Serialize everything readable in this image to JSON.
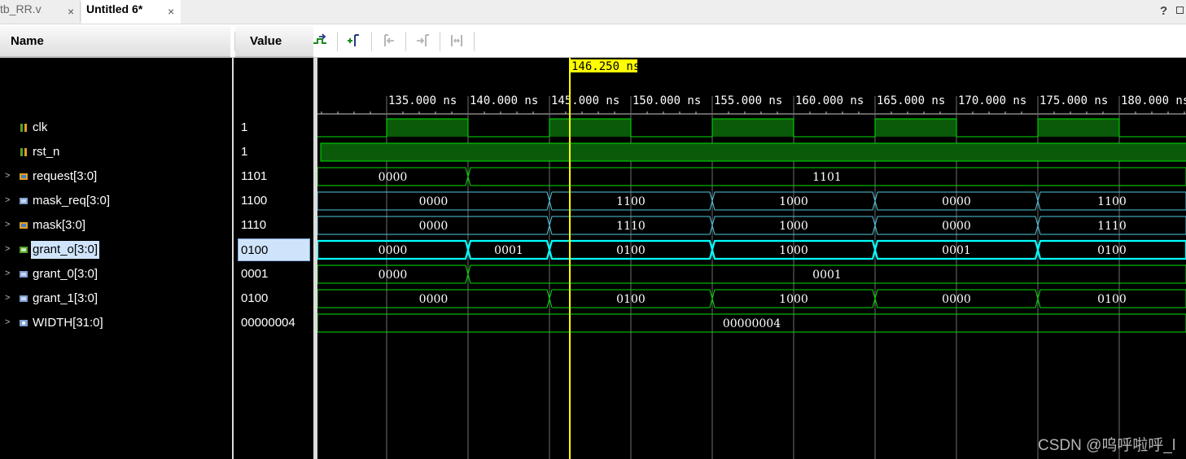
{
  "tabs": [
    {
      "label": "tb_RR.v",
      "close": "×",
      "active": false
    },
    {
      "label": "Untitled 6*",
      "close": "×",
      "active": true
    }
  ],
  "window_controls": {
    "help": "?"
  },
  "toolbar": [
    {
      "name": "search-icon",
      "enabled": true
    },
    {
      "name": "save-icon",
      "enabled": true
    },
    {
      "name": "zoom-in-icon",
      "enabled": true
    },
    {
      "name": "zoom-out-icon",
      "enabled": true
    },
    {
      "name": "zoom-fit-icon",
      "enabled": true
    },
    {
      "name": "go-to-cursor-icon",
      "enabled": true
    },
    {
      "name": "go-to-time-zero-icon",
      "enabled": true
    },
    {
      "name": "go-to-last-time-icon",
      "enabled": true
    },
    {
      "name": "previous-transition-icon",
      "enabled": true
    },
    {
      "name": "next-transition-icon",
      "enabled": true
    },
    {
      "name": "add-marker-icon",
      "enabled": true
    },
    {
      "name": "previous-marker-icon",
      "enabled": false
    },
    {
      "name": "next-marker-icon",
      "enabled": false
    },
    {
      "name": "swap-cursors-icon",
      "enabled": false
    }
  ],
  "columns": {
    "name": "Name",
    "value": "Value"
  },
  "signals": [
    {
      "name": "clk",
      "value": "1",
      "expandable": false,
      "icon": "bit-signal-icon",
      "type": "clock"
    },
    {
      "name": "rst_n",
      "value": "1",
      "expandable": false,
      "icon": "bit-signal-icon",
      "type": "bit"
    },
    {
      "name": "request[3:0]",
      "value": "1101",
      "expandable": true,
      "icon": "input-bus-icon",
      "type": "bus"
    },
    {
      "name": "mask_req[3:0]",
      "value": "1100",
      "expandable": true,
      "icon": "bus-icon",
      "type": "bus"
    },
    {
      "name": "mask[3:0]",
      "value": "1110",
      "expandable": true,
      "icon": "input-bus-icon",
      "type": "bus"
    },
    {
      "name": "grant_o[3:0]",
      "value": "0100",
      "expandable": true,
      "icon": "output-bus-icon",
      "type": "bus",
      "selected": true
    },
    {
      "name": "grant_0[3:0]",
      "value": "0001",
      "expandable": true,
      "icon": "bus-icon",
      "type": "bus"
    },
    {
      "name": "grant_1[3:0]",
      "value": "0100",
      "expandable": true,
      "icon": "bus-icon",
      "type": "bus"
    },
    {
      "name": "WIDTH[31:0]",
      "value": "00000004",
      "expandable": true,
      "icon": "parameter-bus-icon",
      "type": "bus"
    }
  ],
  "timeline": {
    "unit": "ns",
    "cursor": 146.25,
    "cursor_label": "146.250 ns",
    "start": 130.75,
    "end": 184.1,
    "ticks": [
      {
        "t": 135,
        "label": "135.000 ns"
      },
      {
        "t": 140,
        "label": "140.000 ns"
      },
      {
        "t": 145,
        "label": "145.000 ns"
      },
      {
        "t": 150,
        "label": "150.000 ns"
      },
      {
        "t": 155,
        "label": "155.000 ns"
      },
      {
        "t": 160,
        "label": "160.000 ns"
      },
      {
        "t": 165,
        "label": "165.000 ns"
      },
      {
        "t": 170,
        "label": "170.000 ns"
      },
      {
        "t": 175,
        "label": "175.000 ns"
      },
      {
        "t": 180,
        "label": "180.000 ns"
      }
    ]
  },
  "waveforms": {
    "clk": {
      "high_intervals": [
        [
          135,
          140
        ],
        [
          145,
          150
        ],
        [
          155,
          160
        ],
        [
          165,
          170
        ],
        [
          175,
          180
        ]
      ]
    },
    "rst_n": {
      "level": 1
    },
    "request": {
      "color": "#00e000",
      "segments": [
        {
          "start": 130.75,
          "end": 140,
          "label": "0000"
        },
        {
          "start": 140,
          "end": 184.1,
          "label": "1101"
        }
      ]
    },
    "mask_req": {
      "color": "#4fc8e0",
      "segments": [
        {
          "start": 130.75,
          "end": 145,
          "label": "0000"
        },
        {
          "start": 145,
          "end": 155,
          "label": "1100"
        },
        {
          "start": 155,
          "end": 165,
          "label": "1000"
        },
        {
          "start": 165,
          "end": 175,
          "label": "0000"
        },
        {
          "start": 175,
          "end": 184.1,
          "label": "1100"
        }
      ]
    },
    "mask": {
      "color": "#4fc8e0",
      "segments": [
        {
          "start": 130.75,
          "end": 145,
          "label": "0000"
        },
        {
          "start": 145,
          "end": 155,
          "label": "1110"
        },
        {
          "start": 155,
          "end": 165,
          "label": "1000"
        },
        {
          "start": 165,
          "end": 175,
          "label": "0000"
        },
        {
          "start": 175,
          "end": 184.1,
          "label": "1110"
        }
      ]
    },
    "grant_o": {
      "color": "#00ffff",
      "bold": true,
      "segments": [
        {
          "start": 130.75,
          "end": 140,
          "label": "0000"
        },
        {
          "start": 140,
          "end": 145,
          "label": "0001"
        },
        {
          "start": 145,
          "end": 155,
          "label": "0100"
        },
        {
          "start": 155,
          "end": 165,
          "label": "1000"
        },
        {
          "start": 165,
          "end": 175,
          "label": "0001"
        },
        {
          "start": 175,
          "end": 184.1,
          "label": "0100"
        }
      ]
    },
    "grant_0": {
      "color": "#00e000",
      "segments": [
        {
          "start": 130.75,
          "end": 140,
          "label": "0000"
        },
        {
          "start": 140,
          "end": 184.1,
          "label": "0001"
        }
      ]
    },
    "grant_1": {
      "color": "#00e000",
      "segments": [
        {
          "start": 130.75,
          "end": 145,
          "label": "0000"
        },
        {
          "start": 145,
          "end": 155,
          "label": "0100"
        },
        {
          "start": 155,
          "end": 165,
          "label": "1000"
        },
        {
          "start": 165,
          "end": 175,
          "label": "0000"
        },
        {
          "start": 175,
          "end": 184.1,
          "label": "0100"
        }
      ]
    },
    "WIDTH": {
      "color": "#00e000",
      "segments": [
        {
          "start": 130.75,
          "end": 184.1,
          "label": "00000004"
        }
      ]
    }
  },
  "colors": {
    "signal_green": "#00e000",
    "clk_fill": "#0a5a0a",
    "cursor": "#ffff00",
    "grid": "#6e6e6e",
    "selected_bg": "#cfe4fb"
  },
  "watermark": "CSDN @呜呼啦呼_l"
}
